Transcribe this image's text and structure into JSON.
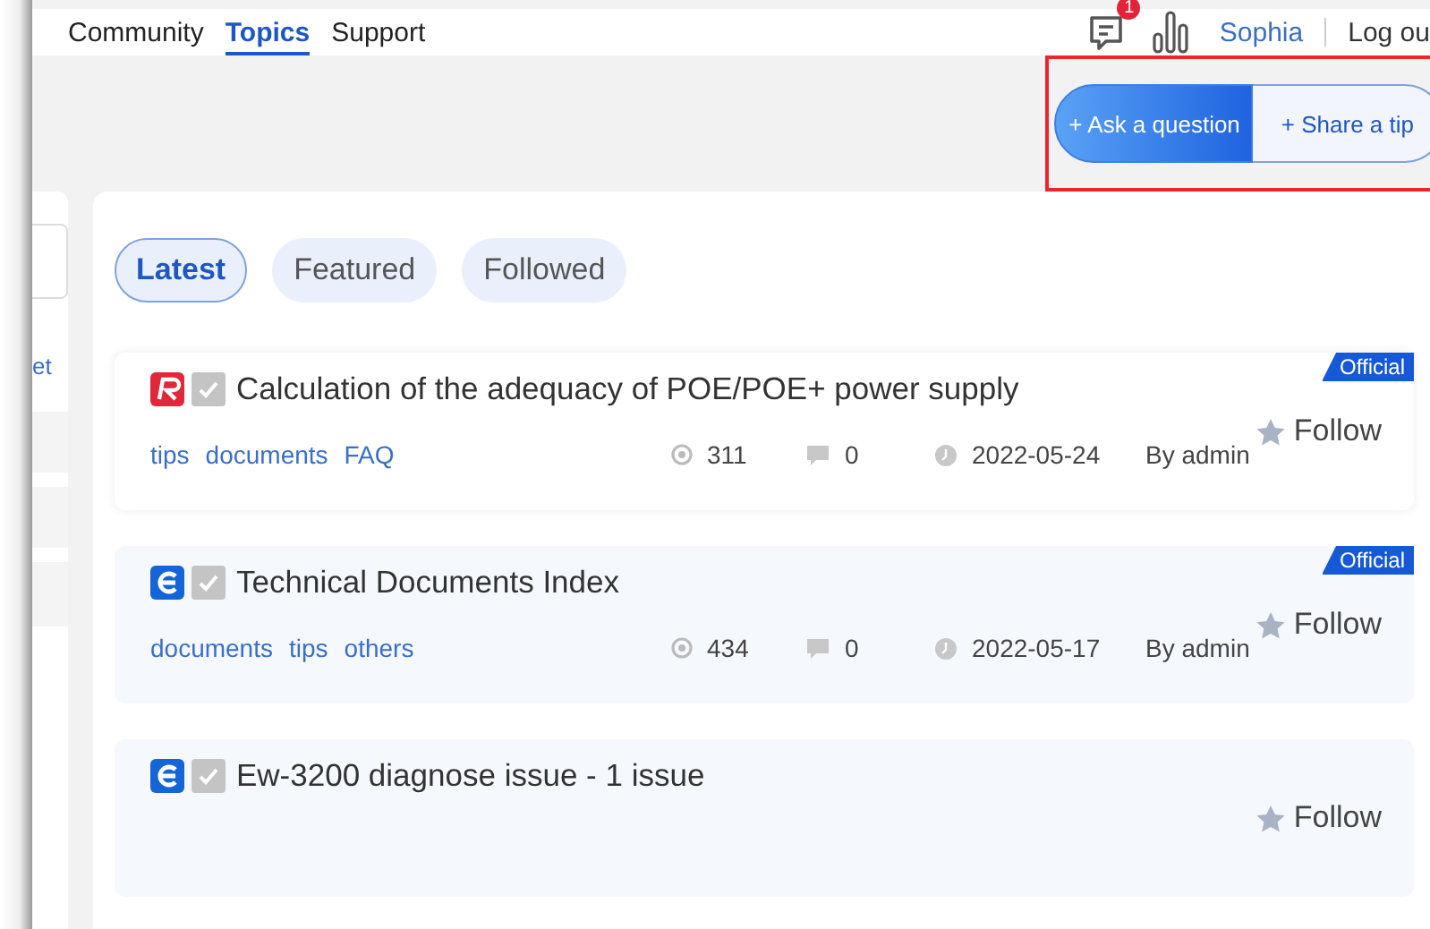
{
  "nav": [
    {
      "label": "Community",
      "selected": false
    },
    {
      "label": "Topics",
      "selected": true
    },
    {
      "label": "Support",
      "selected": false
    }
  ],
  "header": {
    "message_count": "1",
    "user": "Sophia",
    "logout": "Log ou"
  },
  "actions": [
    {
      "label": "+ Ask a question",
      "selected": true
    },
    {
      "label": "+ Share a tip",
      "selected": false
    }
  ],
  "sidebar": {
    "link": "et"
  },
  "filters": [
    {
      "label": "Latest",
      "selected": true
    },
    {
      "label": "Featured",
      "selected": false
    },
    {
      "label": "Followed",
      "selected": false
    }
  ],
  "topics": [
    {
      "kind": "red_logo",
      "checked": true,
      "title": "Calculation of the adequacy of POE/POE+ power supply",
      "tags": [
        "tips",
        "documents",
        "FAQ"
      ],
      "views": "311",
      "replies": "0",
      "date": "2022-05-24",
      "author": "By admin",
      "badge": "Official",
      "follow": "Follow",
      "followed": false
    },
    {
      "kind": "blue_logo",
      "checked": true,
      "title": "Technical Documents Index",
      "tags": [
        "documents",
        "tips",
        "others"
      ],
      "views": "434",
      "replies": "0",
      "date": "2022-05-17",
      "author": "By admin",
      "badge": "Official",
      "follow": "Follow",
      "followed": false
    },
    {
      "kind": "blue_logo",
      "checked": true,
      "title": "Ew-3200 diagnose issue - 1 issue",
      "follow": "Follow",
      "followed": false
    }
  ]
}
